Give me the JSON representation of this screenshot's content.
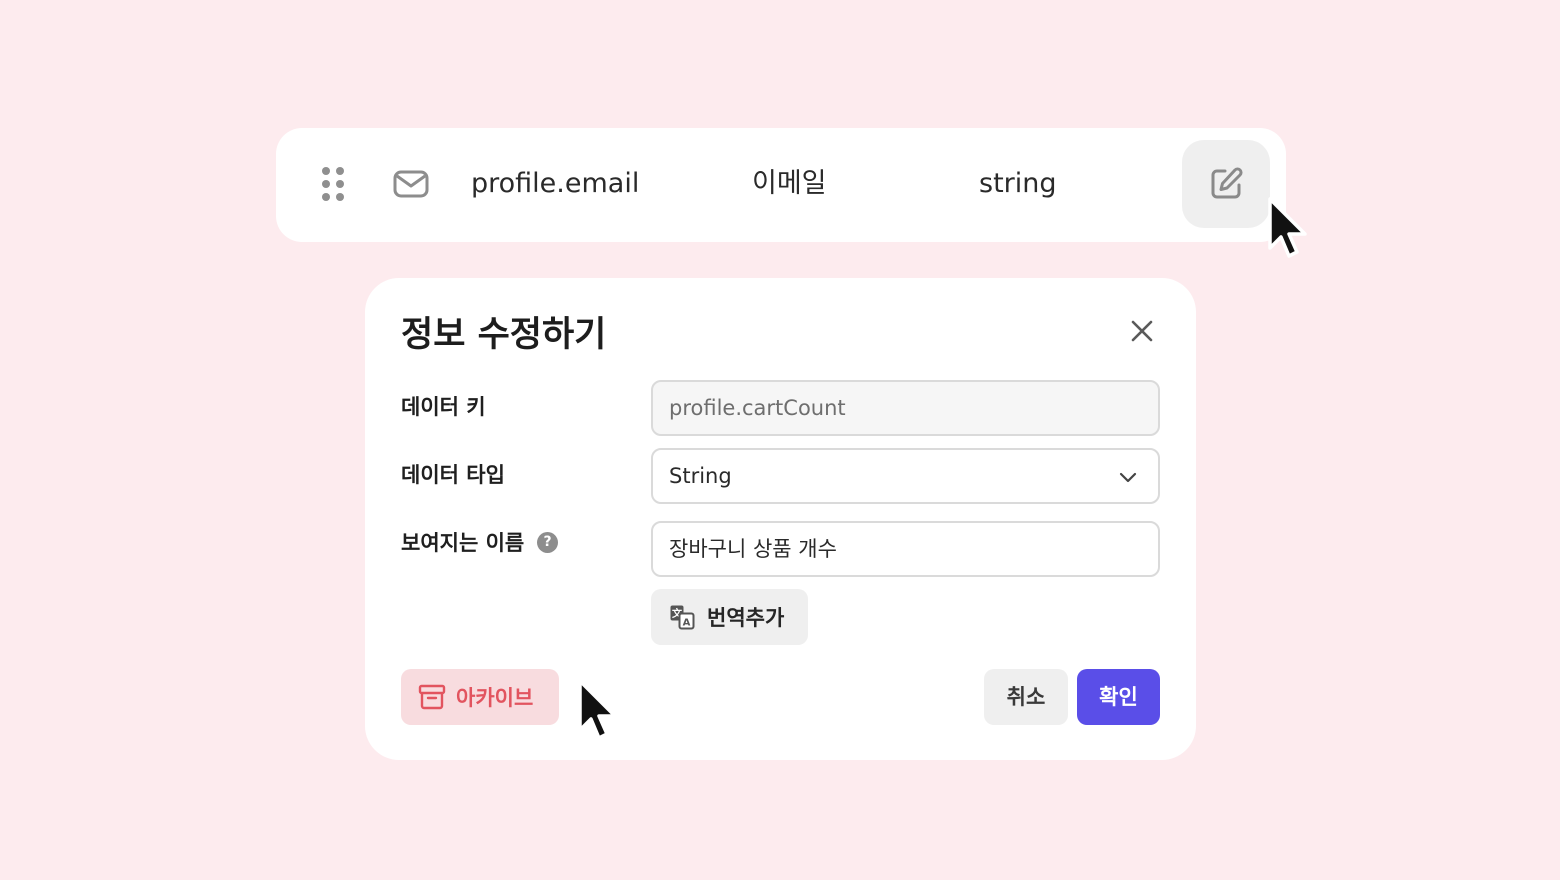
{
  "row": {
    "key": "profile.email",
    "display_name": "이메일",
    "type": "string",
    "type_icon": "mail-icon"
  },
  "modal": {
    "title": "정보 수정하기",
    "fields": {
      "key_label": "데이터 키",
      "key_value": "profile.cartCount",
      "type_label": "데이터 타입",
      "type_value": "String",
      "name_label": "보여지는 이름",
      "name_value": "장바구니 상품 개수",
      "help_icon_glyph": "?"
    },
    "translate_button": "번역추가",
    "archive_button": "아카이브",
    "cancel_button": "취소",
    "confirm_button": "확인"
  },
  "colors": {
    "background": "#fdebee",
    "accent": "#5a4ee8",
    "danger": "#e2545f",
    "danger_bg": "#f8dcdf"
  }
}
